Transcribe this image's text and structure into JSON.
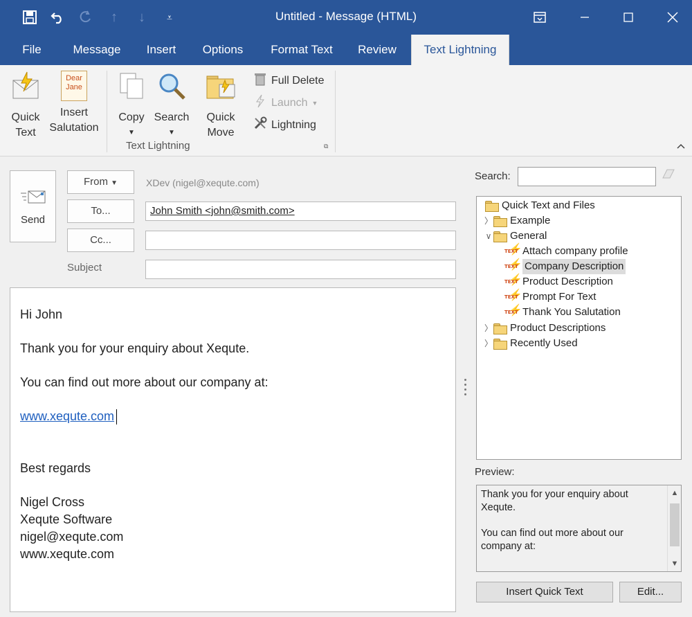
{
  "window": {
    "title": "Untitled - Message (HTML)",
    "quick_access": [
      "save-icon",
      "undo-icon",
      "redo-icon",
      "up-arrow-icon",
      "down-arrow-icon",
      "customize-icon"
    ],
    "controls": [
      "ribbon-display-icon",
      "minimize-icon",
      "maximize-icon",
      "close-icon"
    ]
  },
  "tabs": [
    "File",
    "Message",
    "Insert",
    "Options",
    "Format Text",
    "Review",
    "Text Lightning"
  ],
  "active_tab": "Text Lightning",
  "ribbon": {
    "quick_text": [
      "Quick",
      "Text"
    ],
    "insert_salutation": [
      "Insert",
      "Salutation"
    ],
    "salutation_icon_text": [
      "Dear",
      "Jane"
    ],
    "copy": "Copy",
    "search": "Search",
    "quick_move": [
      "Quick",
      "Move"
    ],
    "full_delete": "Full Delete",
    "launch": "Launch",
    "lightning": "Lightning",
    "group_label": "Text Lightning"
  },
  "compose": {
    "send": "Send",
    "from_button": "From",
    "from_value": "XDev (nigel@xequte.com)",
    "to_button": "To...",
    "to_value": "John Smith <john@smith.com>",
    "cc_button": "Cc...",
    "cc_value": "",
    "subject_label": "Subject",
    "subject_value": ""
  },
  "body": {
    "greeting": "Hi John",
    "line1": "Thank you for your enquiry about Xequte.",
    "line2": "You can find out more about our company at:",
    "link": "www.xequte.com",
    "closing": "Best regards",
    "signature": [
      "Nigel Cross",
      "Xequte Software",
      "nigel@xequte.com",
      "www.xequte.com"
    ]
  },
  "pane": {
    "search_label": "Search:",
    "search_value": "",
    "tree": {
      "root": "Quick Text and Files",
      "example": "Example",
      "general": "General",
      "general_items": [
        "Attach company profile",
        "Company Description",
        "Product Description",
        "Prompt For Text",
        "Thank You Salutation"
      ],
      "selected": "Company Description",
      "product_descriptions": "Product Descriptions",
      "recently_used": "Recently Used",
      "item_icon_text": "TEXT"
    },
    "preview_label": "Preview:",
    "preview_lines": [
      "Thank you for your enquiry about",
      "Xequte.",
      "",
      "You can find out more about our",
      "company at:"
    ],
    "insert_button": "Insert Quick Text",
    "edit_button": "Edit..."
  }
}
